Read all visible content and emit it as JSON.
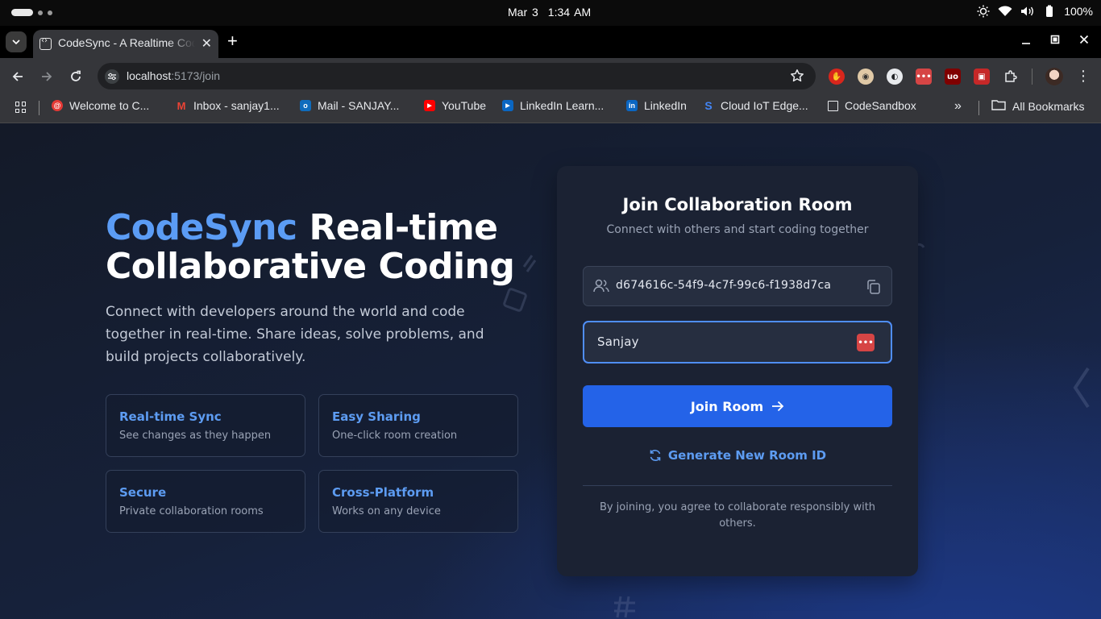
{
  "os": {
    "date": "Mar 3",
    "time": "1:34 AM",
    "battery": "100%"
  },
  "browser": {
    "tab_title": "CodeSync - A Realtime Code Editor",
    "url_host": "localhost",
    "url_path": ":5173/join",
    "bookmarks": [
      {
        "label": "Welcome to C...",
        "icon": "welcome-icon",
        "color": "#e53935"
      },
      {
        "label": "Inbox - sanjay1...",
        "icon": "gmail-icon",
        "color": "#ea4335"
      },
      {
        "label": "Mail - SANJAY...",
        "icon": "outlook-icon",
        "color": "#0f6cbd"
      },
      {
        "label": "YouTube",
        "icon": "youtube-icon",
        "color": "#ff0000"
      },
      {
        "label": "LinkedIn Learn...",
        "icon": "linkedin-learning-icon",
        "color": "#0a66c2"
      },
      {
        "label": "LinkedIn",
        "icon": "linkedin-icon",
        "color": "#0a66c2"
      },
      {
        "label": "Cloud IoT Edge...",
        "icon": "cloud-iot-icon",
        "color": "#4285f4"
      },
      {
        "label": "CodeSandbox",
        "icon": "codesandbox-icon",
        "color": "#e8eaed"
      }
    ],
    "all_bookmarks": "All Bookmarks"
  },
  "hero": {
    "brand": "CodeSync",
    "title_rest_1": " Real-time",
    "title_line_2": "Collaborative Coding",
    "description": "Connect with developers around the world and code together in real-time. Share ideas, solve problems, and build projects collaboratively."
  },
  "features": [
    {
      "title": "Real-time Sync",
      "desc": "See changes as they happen"
    },
    {
      "title": "Easy Sharing",
      "desc": "One-click room creation"
    },
    {
      "title": "Secure",
      "desc": "Private collaboration rooms"
    },
    {
      "title": "Cross-Platform",
      "desc": "Works on any device"
    }
  ],
  "card": {
    "title": "Join Collaboration Room",
    "subtitle": "Connect with others and start coding together",
    "room_id": "d674616c-54f9-4c7f-99c6-f1938d7ca",
    "username": "Sanjay",
    "join_label": "Join Room",
    "generate_label": "Generate New Room ID",
    "footer": "By joining, you agree to collaborate responsibly with others."
  },
  "colors": {
    "accent": "#2463e8",
    "brand_blue": "#5b9cf5",
    "card_bg": "#1b2233"
  }
}
